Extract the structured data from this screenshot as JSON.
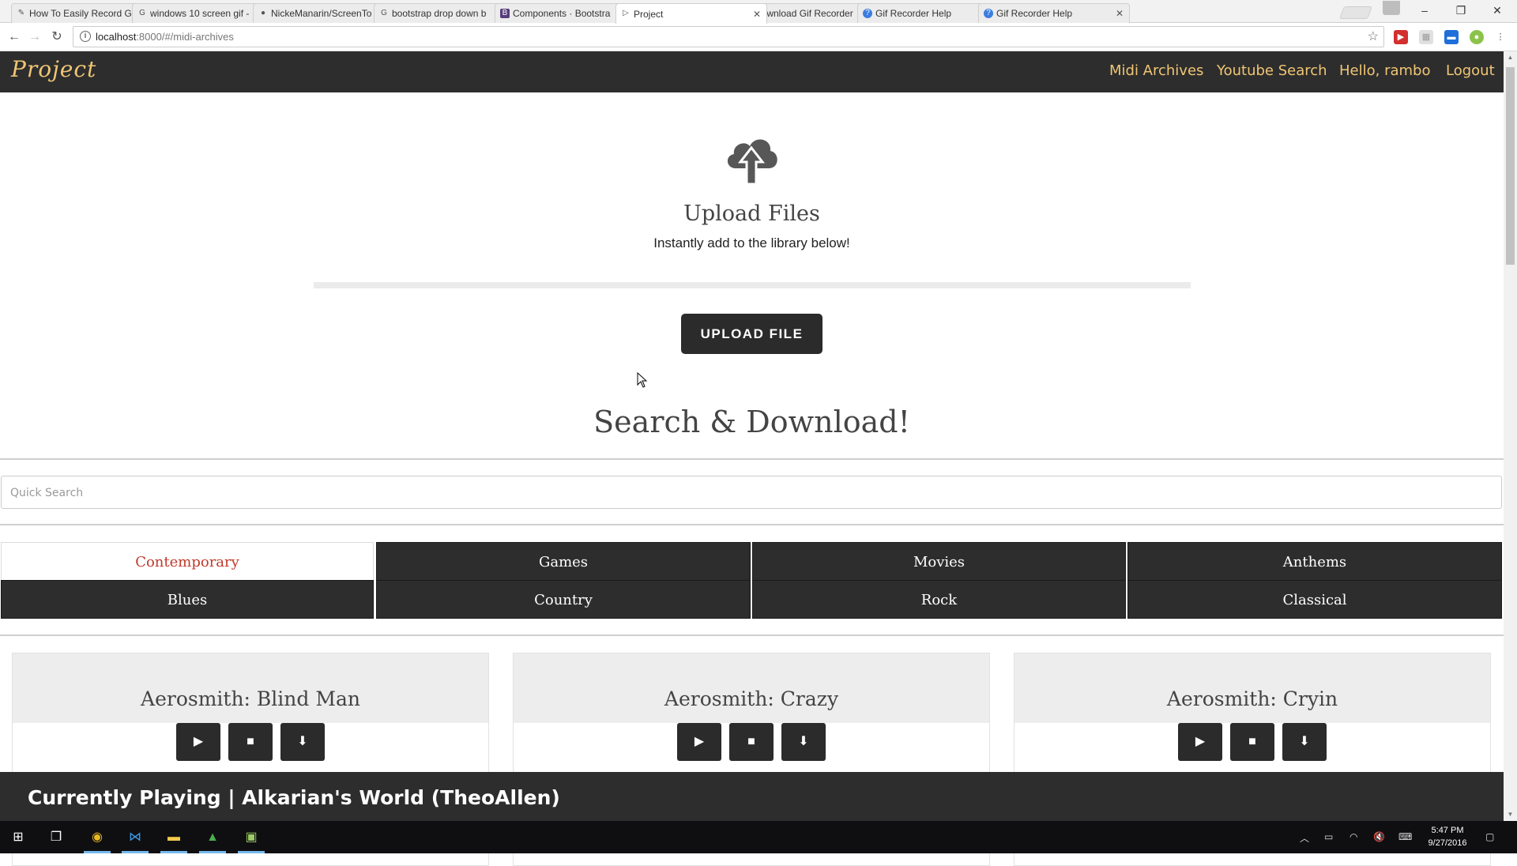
{
  "browser": {
    "tabs": [
      {
        "title": "How To Easily Record Gi",
        "favicon": "quill-icon"
      },
      {
        "title": "windows 10 screen gif -",
        "favicon": "google-icon"
      },
      {
        "title": "NickeManarin/ScreenTo",
        "favicon": "github-icon"
      },
      {
        "title": "bootstrap drop down b",
        "favicon": "google-icon"
      },
      {
        "title": "Components · Bootstra",
        "favicon": "bootstrap-icon"
      },
      {
        "title": "Project",
        "favicon": "play-icon"
      },
      {
        "title": "Download Gif Recorder",
        "favicon": "film-icon"
      },
      {
        "title": "Gif Recorder Help",
        "favicon": "help-icon"
      },
      {
        "title": "Gif Recorder Help",
        "favicon": "help-icon"
      }
    ],
    "url_host": "localhost",
    "url_rest": ":8000/#/midi-archives"
  },
  "app": {
    "brand": "Project",
    "nav": {
      "midi_archives": "Midi Archives",
      "youtube_search": "Youtube Search",
      "hello": "Hello, rambo",
      "logout": "Logout"
    }
  },
  "upload": {
    "title": "Upload Files",
    "subtitle": "Instantly add to the library below!",
    "button": "UPLOAD FILE"
  },
  "search": {
    "heading": "Search & Download!",
    "placeholder": "Quick Search"
  },
  "genres": {
    "contemporary": "Contemporary",
    "games": "Games",
    "movies": "Movies",
    "anthems": "Anthems",
    "blues": "Blues",
    "country": "Country",
    "rock": "Rock",
    "classical": "Classical",
    "active": "Contemporary"
  },
  "songs": [
    {
      "title": "Aerosmith: Blind Man"
    },
    {
      "title": "Aerosmith: Crazy"
    },
    {
      "title": "Aerosmith: Cryin"
    }
  ],
  "now_playing": "Currently Playing | Alkarian's World (TheoAllen)",
  "taskbar": {
    "time": "5:47 PM",
    "date": "9/27/2016"
  },
  "colors": {
    "nav_bg": "#2d2d2d",
    "nav_link": "#f0c674",
    "active_genre": "#c0392b",
    "button_bg": "#2b2b2b"
  }
}
